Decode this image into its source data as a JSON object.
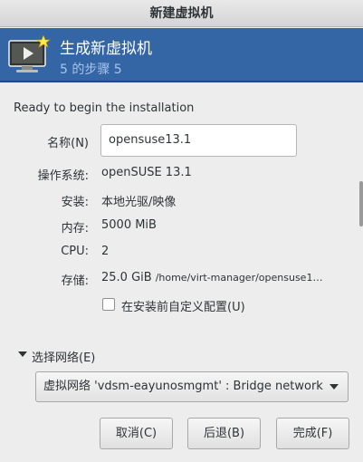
{
  "window": {
    "title": "新建虚拟机"
  },
  "header": {
    "title": "生成新虚拟机",
    "subtitle": "5 的步骤 5",
    "icon": "monitor-star-icon"
  },
  "summary": {
    "ready_text": "Ready to begin the installation",
    "name_label": "名称(N)",
    "name_value": "opensuse13.1",
    "os_label": "操作系统:",
    "os_value": "openSUSE 13.1",
    "install_label": "安装:",
    "install_value": "本地光驱/映像",
    "memory_label": "内存:",
    "memory_value": "5000 MiB",
    "cpu_label": "CPU:",
    "cpu_value": "2",
    "storage_label": "存储:",
    "storage_size": "25.0 GiB",
    "storage_path": "/home/virt-manager/opensuse1…"
  },
  "customize": {
    "label": "在安装前自定义配置(U)",
    "checked": false
  },
  "network": {
    "expander_label": "选择网络(E)",
    "selected": "虚拟网络 'vdsm-eayunosmgmt' : Bridge network"
  },
  "buttons": {
    "cancel": "取消(C)",
    "back": "后退(B)",
    "finish": "完成(F)"
  },
  "colors": {
    "header_bg": "#3465a4",
    "subtitle": "#a8c4ec"
  }
}
